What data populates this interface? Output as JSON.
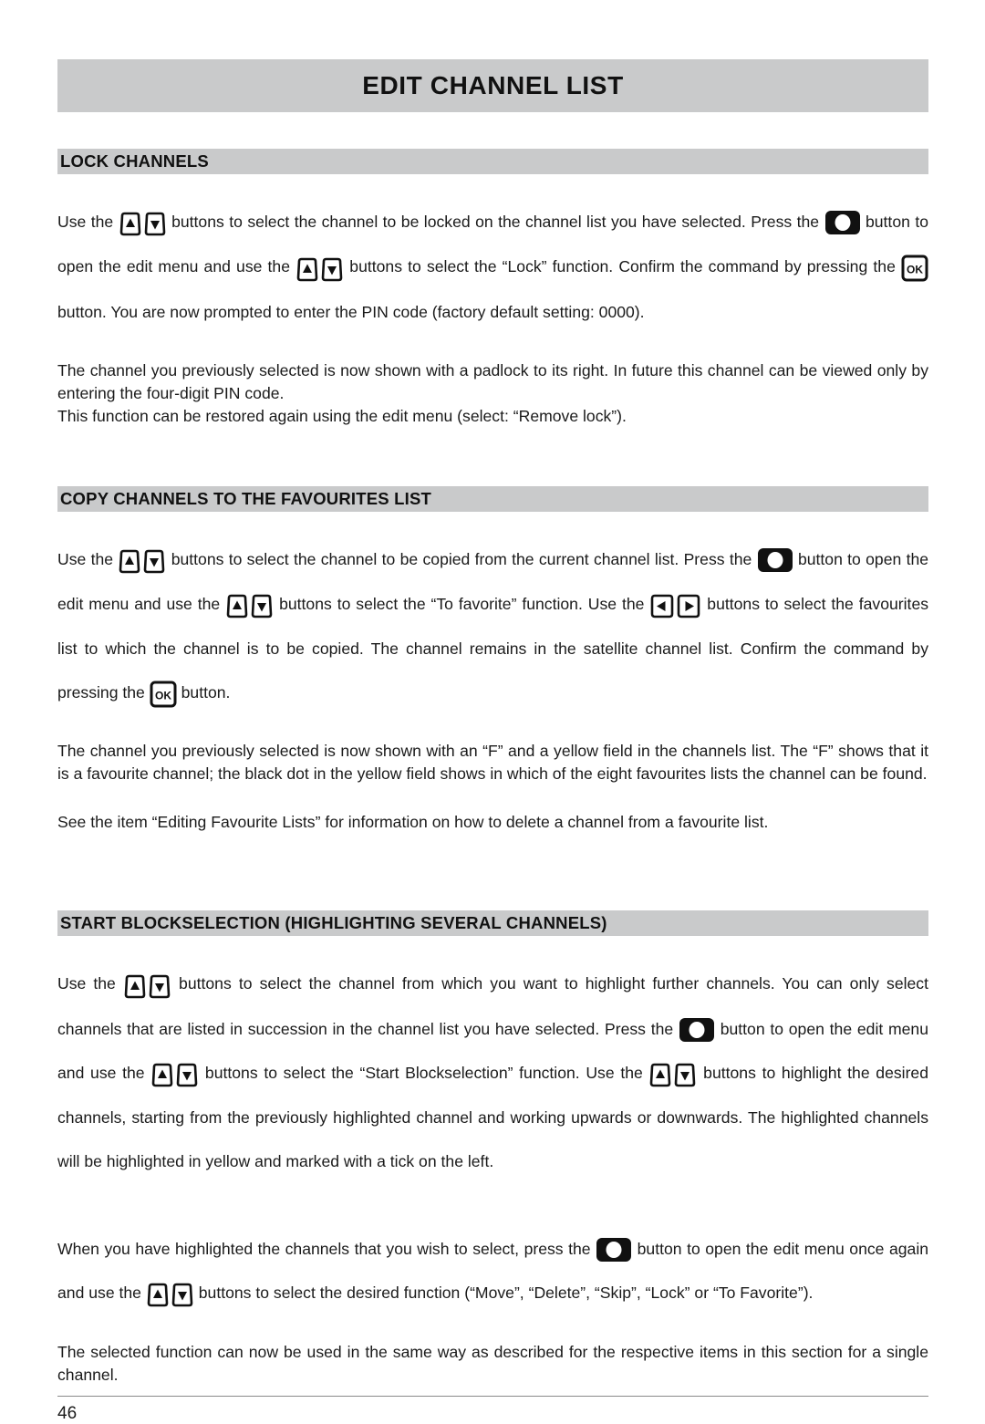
{
  "document": {
    "title": "EDIT CHANNEL LIST",
    "page_number": "46"
  },
  "icons": {
    "up_arrow": "up-arrow-key-icon",
    "down_arrow": "down-arrow-key-icon",
    "left_arrow": "left-arrow-key-icon",
    "right_arrow": "right-arrow-key-icon",
    "round_dot": "dot-menu-key-icon",
    "ok": "ok-key-icon",
    "ok_label": "OK"
  },
  "sections": [
    {
      "heading": "LOCK CHANNELS",
      "paragraphs": {
        "p1_a": "Use the",
        "p1_b": "buttons to select the channel to be locked on the channel list you have selected. Press the",
        "p1_c": "button to open the edit menu and use the",
        "p1_d": "buttons to select the “Lock” function. Confirm the command by pressing the",
        "p1_e": "button. You are now prompted to enter the PIN code (factory default setting: 0000).",
        "p2": "The channel you previously selected is now shown with a padlock to its right. In future this channel can be viewed only by entering the four-digit PIN code.",
        "p3": "This function can be restored again using the edit menu (select: “Remove lock”)."
      }
    },
    {
      "heading": "COPY CHANNELS TO THE FAVOURITES LIST",
      "paragraphs": {
        "p1_a": "Use the",
        "p1_b": "buttons to select the channel to be copied from the current channel list. Press the",
        "p1_c": "button to open the edit menu and use the",
        "p1_d": "buttons to select the “To favorite” function. Use the",
        "p1_e": "buttons to select the favourites list to which the channel is to be copied. The channel remains in the satellite channel list. Confirm the command by pressing the",
        "p1_f": "button.",
        "p2": "The channel you previously selected is now shown with an “F” and a yellow field in the channels list. The “F” shows that it is a favourite channel; the black dot in the yellow field shows in which of the eight favourites lists the channel can be found.",
        "p3": "See the item “Editing Favourite Lists” for information on how to delete a channel from a favourite list."
      }
    },
    {
      "heading": "START BLOCKSELECTION (HIGHLIGHTING SEVERAL CHANNELS)",
      "paragraphs": {
        "p1_a": "Use the",
        "p1_b": "buttons to select the channel from which you want to highlight further channels. You can only select channels that are listed in succession in the channel list you have selected. Press the",
        "p1_c": "button to open the edit menu and use the",
        "p1_d": "buttons to select the “Start Blockselection” function. Use the",
        "p1_e": "buttons to highlight the desired channels, starting from the previously highlighted channel and working upwards or downwards. The highlighted channels will be highlighted in yellow and marked with a tick on the left.",
        "p2_a": "When you have highlighted the channels that you wish to select, press the",
        "p2_b": "button to open the edit menu once again and use the",
        "p2_c": "buttons to select the desired function (“Move”, “Delete”, “Skip”, “Lock” or “To Favorite”).",
        "p3": "The selected function can now be used in the same way as described for the respective items in this section for a single channel."
      }
    }
  ],
  "colors": {
    "bar_gray": "#c9cabb",
    "text": "#1a1a1a",
    "key_black": "#111111"
  }
}
